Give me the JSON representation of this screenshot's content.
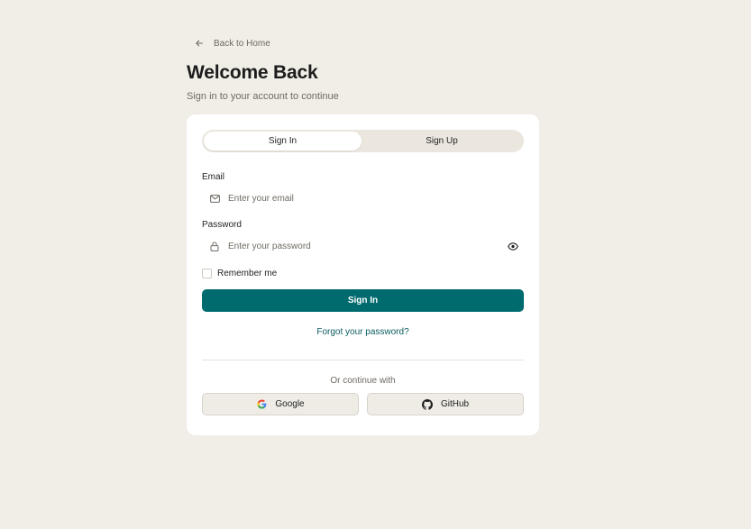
{
  "back_link": {
    "label": "Back to Home",
    "icon": "arrow-left-icon"
  },
  "header": {
    "title": "Welcome Back",
    "subtitle": "Sign in to your account to continue"
  },
  "tabs": [
    {
      "label": "Sign In",
      "active": true
    },
    {
      "label": "Sign Up",
      "active": false
    }
  ],
  "form": {
    "email": {
      "label": "Email",
      "value": "",
      "placeholder": "Enter your email",
      "icon": "mail-icon"
    },
    "password": {
      "label": "Password",
      "value": "",
      "placeholder": "Enter your password",
      "icon": "lock-icon",
      "toggle_icon": "eye-icon"
    },
    "remember": {
      "label": "Remember me",
      "checked": false
    },
    "submit_label": "Sign In",
    "forgot_label": "Forgot your password?"
  },
  "social": {
    "divider_text": "Or continue with",
    "buttons": [
      {
        "label": "Google",
        "icon": "google-icon"
      },
      {
        "label": "GitHub",
        "icon": "github-icon"
      }
    ]
  },
  "colors": {
    "background": "#f1eee7",
    "card": "#ffffff",
    "accent": "#006b6f",
    "link": "#0a5c60",
    "muted_text": "#6f6a63"
  }
}
